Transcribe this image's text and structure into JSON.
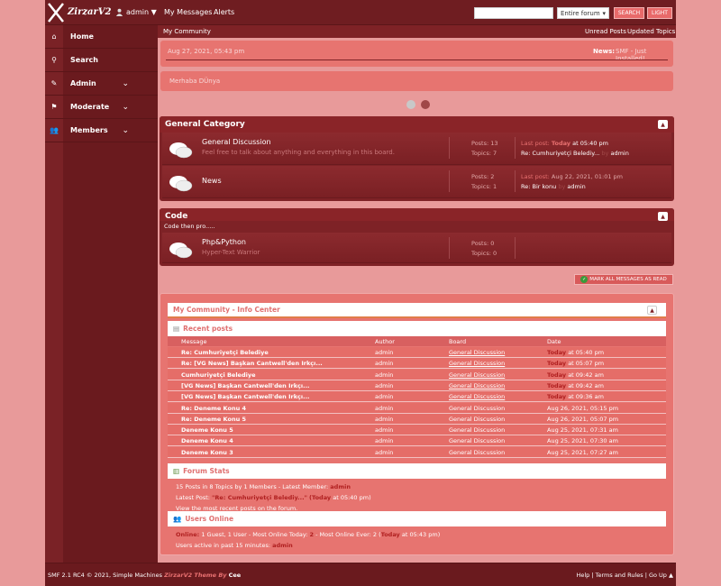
{
  "topbar": {
    "brand": "ZirzarV2",
    "user": "admin ▼",
    "nav": [
      "My Messages",
      "Alerts"
    ],
    "search_select": "Entire forum",
    "search_button": "SEARCH",
    "light_button": "LIGHT"
  },
  "sidebar": {
    "items": [
      {
        "label": "Home",
        "icon": "home-icon"
      },
      {
        "label": "Search",
        "icon": "search-icon"
      },
      {
        "label": "Admin",
        "icon": "admin-icon"
      },
      {
        "label": "Moderate",
        "icon": "moderate-icon"
      },
      {
        "label": "Members",
        "icon": "members-icon"
      }
    ]
  },
  "crumb": {
    "home": "My Community",
    "unread": "Unread Posts",
    "updated": "Updated Topics"
  },
  "news": {
    "date": "Aug 27, 2021, 05:43 pm",
    "label": "News:",
    "text": "SMF - Just Installed!"
  },
  "hello": "Merhaba DÜnya",
  "categories": [
    {
      "title": "General Category",
      "boards": [
        {
          "name": "General Discussion",
          "desc": "Feel free to talk about anything and everything in this board.",
          "posts": "Posts: 13",
          "topics": "Topics: 7",
          "lp_label": "Last post:",
          "lp_when": "Today",
          "lp_time": "at 05:40 pm",
          "lp_subject": "Re: Cumhuriyetçi Belediy...",
          "lp_by": "by",
          "lp_user": "admin"
        },
        {
          "name": "News",
          "desc": "",
          "posts": "Posts: 2",
          "topics": "Topics: 1",
          "lp_label": "Last post:",
          "lp_when": "",
          "lp_time": "Aug 22, 2021, 01:01 pm",
          "lp_subject": "Re: Bir konu",
          "lp_by": "by",
          "lp_user": "admin"
        }
      ]
    },
    {
      "title": "Code",
      "subtitle": "Code then pro.....",
      "boards": [
        {
          "name": "Php&Python",
          "desc": "Hyper-Text Warrior",
          "posts": "Posts: 0",
          "topics": "Topics: 0"
        }
      ]
    }
  ],
  "mark_read": "MARK ALL MESSAGES AS READ",
  "info_center": {
    "title": "My Community - Info Center",
    "recent_title": "Recent posts",
    "headers": [
      "Message",
      "Author",
      "Board",
      "Date"
    ],
    "rows": [
      [
        "Re: Cumhuriyetçi Belediye",
        "admin",
        "General Discussion",
        "Today",
        "at 05:40 pm"
      ],
      [
        "Re: [VG News] Başkan Cantwell'den Irkçı...",
        "admin",
        "General Discussion",
        "Today",
        "at 05:07 pm"
      ],
      [
        "Cumhuriyetçi Belediye",
        "admin",
        "General Discussion",
        "Today",
        "at 09:42 am"
      ],
      [
        "[VG News] Başkan Cantwell'den Irkçı...",
        "admin",
        "General Discussion",
        "Today",
        "at 09:42 am"
      ],
      [
        "[VG News] Başkan Cantwell'den Irkçı...",
        "admin",
        "General Discussion",
        "Today",
        "at 09:36 am"
      ],
      [
        "Re: Deneme Konu 4",
        "admin",
        "General Discussion",
        "",
        "Aug 26, 2021, 05:15 pm"
      ],
      [
        "Re: Deneme Konu 5",
        "admin",
        "General Discussion",
        "",
        "Aug 26, 2021, 05:07 pm"
      ],
      [
        "Deneme Konu 5",
        "admin",
        "General Discussion",
        "",
        "Aug 25, 2021, 07:31 am"
      ],
      [
        "Deneme Konu 4",
        "admin",
        "General Discussion",
        "",
        "Aug 25, 2021, 07:30 am"
      ],
      [
        "Deneme Konu 3",
        "admin",
        "General Discussion",
        "",
        "Aug 25, 2021, 07:27 am"
      ]
    ],
    "stats_title": "Forum Stats",
    "stats_line1_a": "15 Posts in 8 Topics by 1 Members - Latest Member:",
    "stats_line1_user": "admin",
    "stats_line2_a": "Latest Post:",
    "stats_line2_subject": "\"Re: Cumhuriyetçi Belediy...\"",
    "stats_line2_when": "(Today",
    "stats_line2_time": "at 05:40 pm)",
    "stats_line3": "View the most recent posts on the forum.",
    "users_title": "Users Online",
    "users_line1_a": "Online:",
    "users_line1_b": "1 Guest, 1 User",
    "users_line1_c": "- Most Online Today:",
    "users_line1_d": "2",
    "users_line1_e": "- Most Online Ever: 2 (",
    "users_line1_f": "Today",
    "users_line1_g": "at 05:43 pm)",
    "users_line2_a": "Users active in past 15 minutes:",
    "users_line2_user": "admin"
  },
  "footer": {
    "left_a": "SMF 2.1 RC4 © 2021, Simple Machines",
    "left_theme": "ZirzarV2 Theme By",
    "left_author": "Cee",
    "right": "Help | Terms and Rules | Go Up ▲"
  }
}
